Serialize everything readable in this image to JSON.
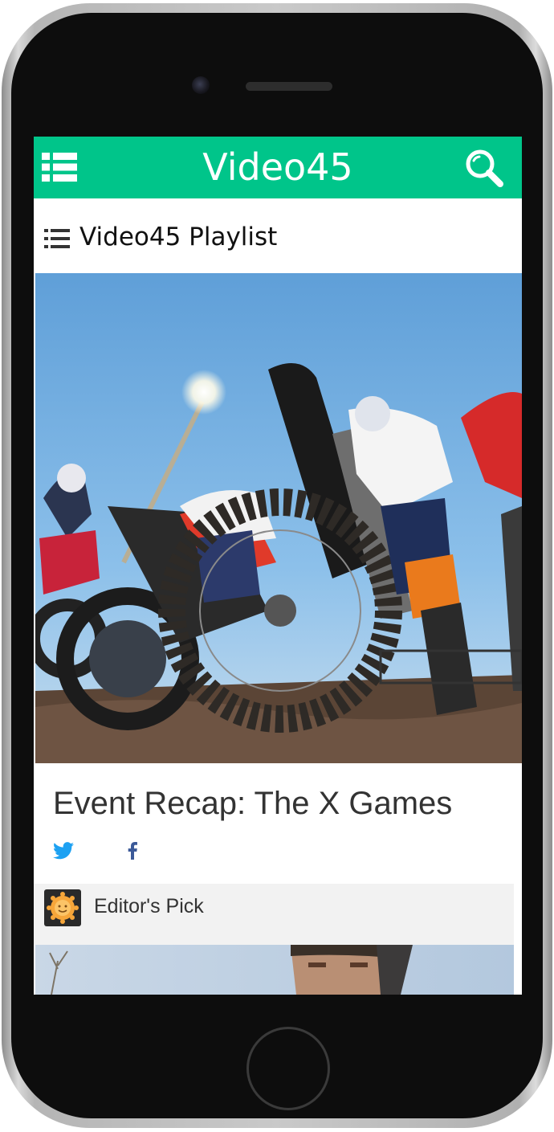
{
  "app": {
    "title": "Video45",
    "accent_color": "#00c58a"
  },
  "header": {
    "menu_icon": "hamburger-menu-icon",
    "search_icon": "search-icon"
  },
  "playlist": {
    "icon": "list-icon",
    "title": "Video45 Playlist"
  },
  "featured_video": {
    "thumbnail": "motocross riders at starting gate",
    "title": "Event Recap: The X Games",
    "share": {
      "twitter_icon": "twitter-icon",
      "facebook_icon": "facebook-icon"
    }
  },
  "editor_pick": {
    "avatar_icon": "sun-avatar-icon",
    "label": "Editor's Pick"
  },
  "next_video": {
    "thumbnail": "person portrait outdoors"
  }
}
